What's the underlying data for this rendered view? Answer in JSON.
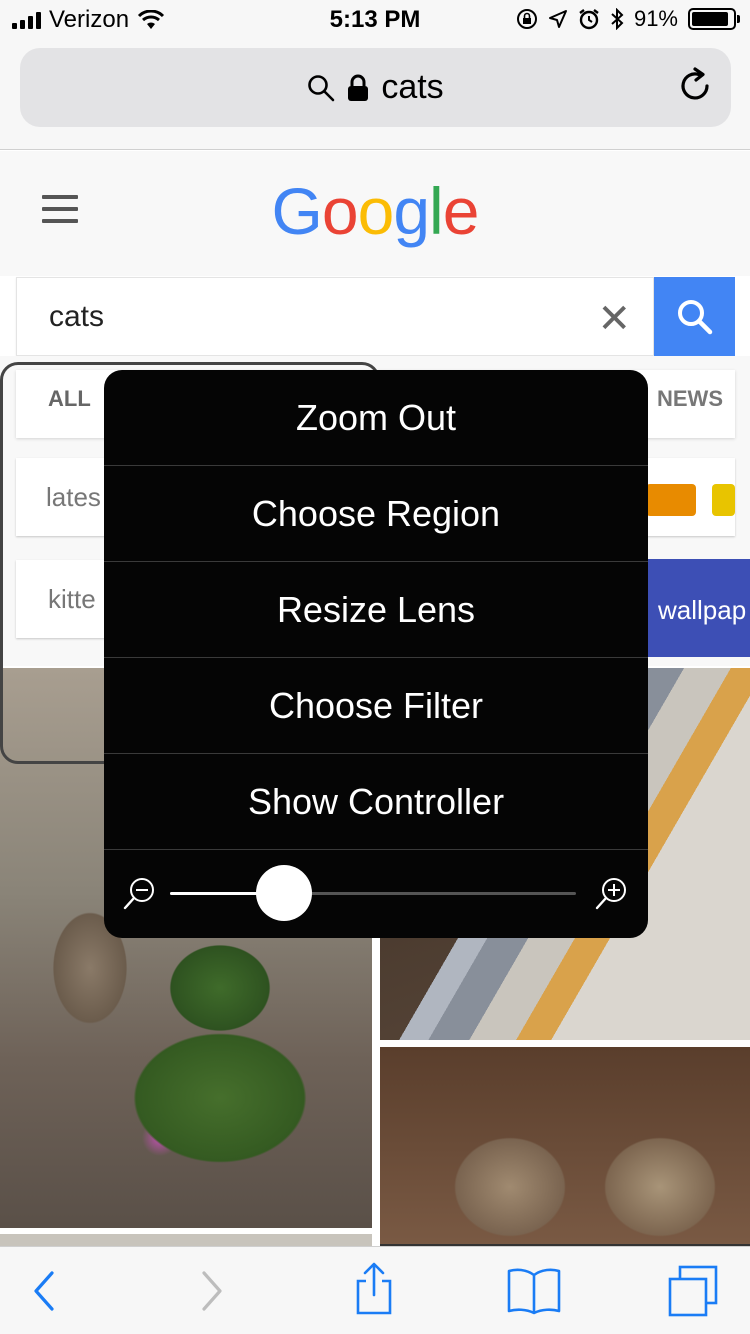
{
  "status_bar": {
    "carrier": "Verizon",
    "time": "5:13 PM",
    "battery_percent": "91%",
    "battery_level": 0.91,
    "icons": [
      "signal-icon",
      "wifi-icon",
      "rotation-lock-icon",
      "location-icon",
      "alarm-icon",
      "bluetooth-icon",
      "battery-icon"
    ]
  },
  "browser": {
    "url_text": "cats",
    "icons": [
      "search-icon",
      "lock-icon",
      "reload-icon"
    ]
  },
  "google": {
    "logo_letters": [
      {
        "char": "G",
        "color": "#4285f4"
      },
      {
        "char": "o",
        "color": "#ea4335"
      },
      {
        "char": "o",
        "color": "#fbbc05"
      },
      {
        "char": "g",
        "color": "#4285f4"
      },
      {
        "char": "l",
        "color": "#34a853"
      },
      {
        "char": "e",
        "color": "#ea4335"
      }
    ],
    "search_query": "cats",
    "search_button_color": "#4285f4"
  },
  "tabs": {
    "all": "ALL",
    "news": "NEWS"
  },
  "chips": {
    "latest": "lates",
    "kitten": "kitte",
    "wallpaper": "wallpap",
    "accent_orange": "#e88b00",
    "accent_yellow": "#e8c400",
    "accent_blue": "#3d4fb5"
  },
  "zoom_menu": {
    "items": [
      "Zoom Out",
      "Choose Region",
      "Resize Lens",
      "Choose Filter",
      "Show Controller"
    ],
    "zoom_level": 0.28
  },
  "toolbar": {
    "icons": [
      "back-icon",
      "forward-icon",
      "share-icon",
      "bookmarks-icon",
      "tabs-icon"
    ],
    "accent": "#1a7cf5"
  }
}
